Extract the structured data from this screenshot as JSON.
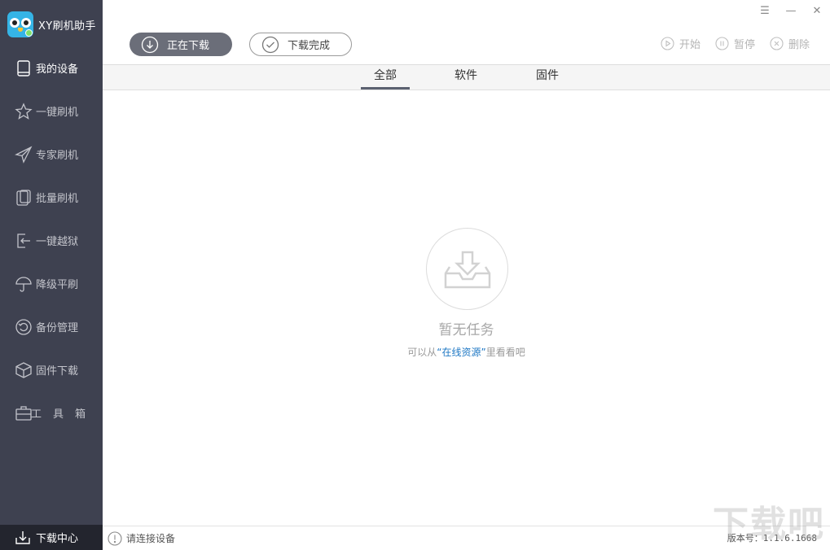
{
  "app": {
    "title": "XY刷机助手"
  },
  "window_controls": {
    "menu": "☰",
    "minimize": "—",
    "close": "✕"
  },
  "sidebar": {
    "items": [
      {
        "label": "我的设备",
        "icon": "phone-icon"
      },
      {
        "label": "一键刷机",
        "icon": "star-icon"
      },
      {
        "label": "专家刷机",
        "icon": "paper-plane-icon"
      },
      {
        "label": "批量刷机",
        "icon": "devices-icon"
      },
      {
        "label": "一键越狱",
        "icon": "exit-icon"
      },
      {
        "label": "降级平刷",
        "icon": "umbrella-icon"
      },
      {
        "label": "备份管理",
        "icon": "backup-icon"
      },
      {
        "label": "固件下载",
        "icon": "box-icon"
      },
      {
        "label": "工具箱",
        "icon": "toolbox-icon"
      }
    ],
    "download_center": "下载中心"
  },
  "toolbar": {
    "downloading": "正在下载",
    "completed": "下载完成",
    "start": "开始",
    "pause": "暂停",
    "delete": "删除"
  },
  "tabs": {
    "all": "全部",
    "software": "软件",
    "firmware": "固件"
  },
  "empty": {
    "title": "暂无任务",
    "hint_prefix": "可以从",
    "hint_link": "“在线资源”",
    "hint_suffix": "里看看吧"
  },
  "status": {
    "message": "请连接设备",
    "version": "版本号：1.1.6.1668"
  },
  "watermark": "下载吧",
  "colors": {
    "sidebar": "#3e4150",
    "accent_link": "#1f78c4",
    "pill_dark": "#6b6e79"
  }
}
